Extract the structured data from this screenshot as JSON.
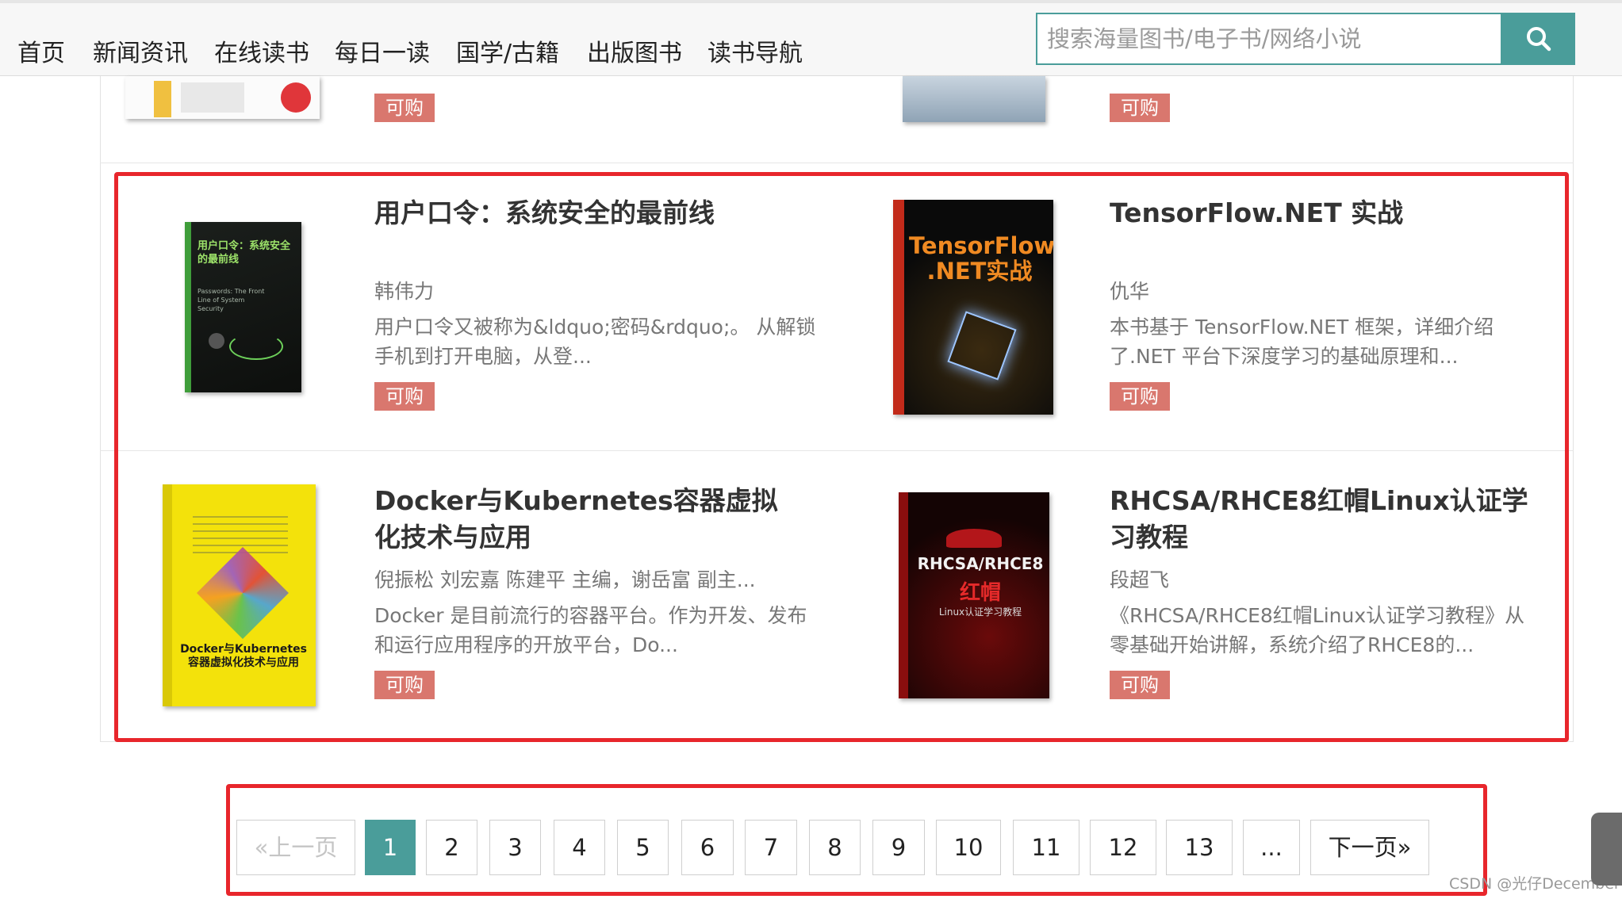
{
  "nav": {
    "items": [
      "首页",
      "新闻资讯",
      "在线读书",
      "每日一读",
      "国学/古籍",
      "出版图书",
      "读书导航"
    ],
    "search_placeholder": "搜索海量图书/电子书/网络小说"
  },
  "prev_row": {
    "badges": [
      "可购",
      "可购"
    ]
  },
  "books": [
    {
      "title": "用户口令：系统安全的最前线",
      "author": "韩伟力",
      "desc": "用户口令又被称为&ldquo;密码&rdquo;。 从解锁手机到打开电脑，从登...",
      "badge": "可购",
      "cover": {
        "text_main": "用户口令：系统安全的最前线",
        "text_sub": "Passwords: The Front Line of System Security"
      }
    },
    {
      "title": "TensorFlow.NET 实战",
      "author": "仇华",
      "desc": "本书基于 TensorFlow.NET 框架，详细介绍了.NET 平台下深度学习的基础原理和...",
      "badge": "可购",
      "cover": {
        "text_main": "TensorFlow .NET实战"
      }
    },
    {
      "title": "Docker与Kubernetes容器虚拟化技术与应用",
      "author": "倪振松 刘宏嘉 陈建平 主编，谢岳富 副主...",
      "desc": "Docker 是目前流行的容器平台。作为开发、发布和运行应用程序的开放平台，Do...",
      "badge": "可购",
      "cover": {
        "text_main": "Docker与Kubernetes 容器虚拟化技术与应用"
      }
    },
    {
      "title": "RHCSA/RHCE8红帽Linux认证学习教程",
      "author": "段超飞",
      "desc": "《RHCSA/RHCE8红帽Linux认证学习教程》从零基础开始讲解，系统介绍了RHCE8的...",
      "badge": "可购",
      "cover": {
        "text_main": "RHCSA/RHCE8",
        "text_red": "红帽",
        "text_sub": "Linux认证学习教程"
      }
    }
  ],
  "pagination": {
    "prev": "«上一页",
    "pages": [
      "1",
      "2",
      "3",
      "4",
      "5",
      "6",
      "7",
      "8",
      "9",
      "10",
      "11",
      "12",
      "13"
    ],
    "ellipsis": "...",
    "next": "下一页»",
    "current": "1"
  },
  "watermark": "CSDN @光仔December",
  "colors": {
    "accent": "#4a9d9a",
    "badge": "#d9776e",
    "highlight": "#e8262c"
  }
}
